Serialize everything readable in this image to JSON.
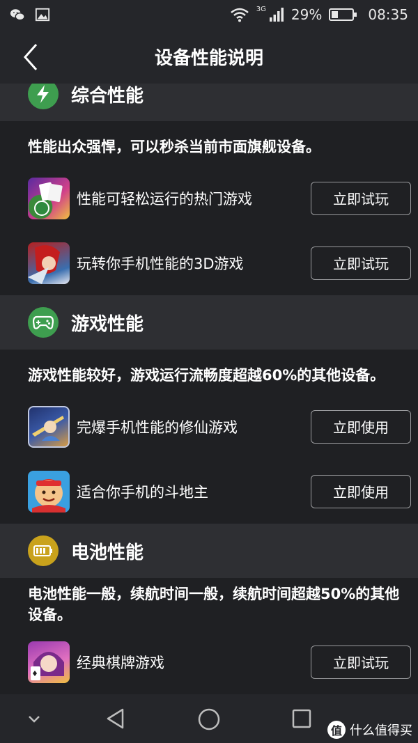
{
  "status_bar": {
    "network": "3G",
    "battery_percent": "29%",
    "time": "08:35",
    "icons": [
      "wechat-icon",
      "image-icon",
      "wifi-icon",
      "signal-icon",
      "battery-icon"
    ]
  },
  "header": {
    "title": "设备性能说明"
  },
  "sections": [
    {
      "title": "综合性能",
      "icon": "lightning-icon",
      "icon_color": "#3e9e4f",
      "description": "性能出众强悍，可以秒杀当前市面旗舰设备。",
      "items": [
        {
          "name": "性能可轻松运行的热门游戏",
          "button": "立即试玩"
        },
        {
          "name": "玩转你手机性能的3D游戏",
          "button": "立即试玩"
        }
      ]
    },
    {
      "title": "游戏性能",
      "icon": "gamepad-icon",
      "icon_color": "#3e9e4f",
      "description": "游戏性能较好，游戏运行流畅度超越60%的其他设备。",
      "items": [
        {
          "name": "完爆手机性能的修仙游戏",
          "button": "立即使用"
        },
        {
          "name": "适合你手机的斗地主",
          "button": "立即使用"
        }
      ]
    },
    {
      "title": "电池性能",
      "icon": "battery-icon",
      "icon_color": "#c9a21c",
      "description": "电池性能一般，续航时间一般，续航时间超越50%的其他设备。",
      "items": [
        {
          "name": "经典棋牌游戏",
          "button": "立即试玩"
        }
      ]
    }
  ],
  "watermark": {
    "text": "什么值得买",
    "icon_text": "值"
  }
}
